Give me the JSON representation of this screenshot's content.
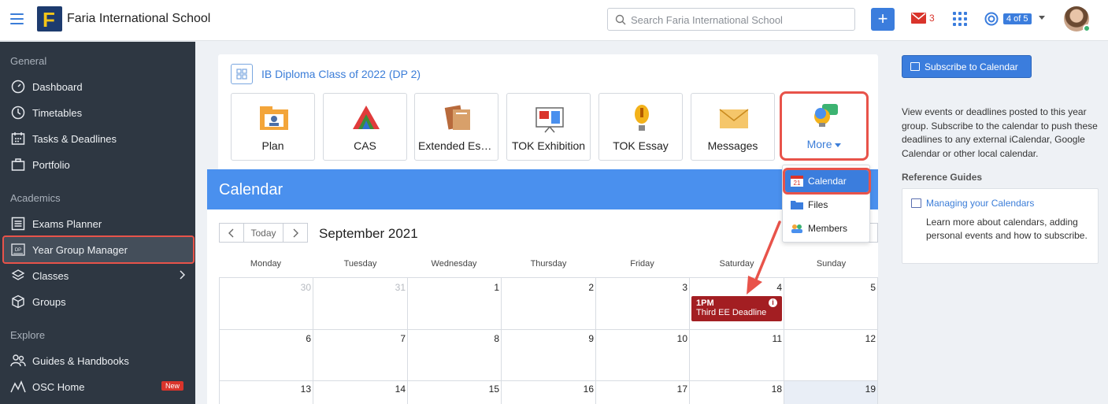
{
  "header": {
    "school_name": "Faria International School",
    "search_placeholder": "Search Faria International School",
    "plus_label": "+",
    "mail_count": "3",
    "help_badge": "4 of 5"
  },
  "sidebar": {
    "sections": {
      "general": "General",
      "academics": "Academics",
      "explore": "Explore"
    },
    "items": [
      {
        "label": "Dashboard"
      },
      {
        "label": "Timetables"
      },
      {
        "label": "Tasks & Deadlines"
      },
      {
        "label": "Portfolio"
      },
      {
        "label": "Exams Planner"
      },
      {
        "label": "Year Group Manager"
      },
      {
        "label": "Classes"
      },
      {
        "label": "Groups"
      },
      {
        "label": "Guides & Handbooks"
      },
      {
        "label": "OSC Home"
      }
    ],
    "new_badge": "New",
    "dp_icon_text": "DP"
  },
  "class_header": {
    "title": "IB Diploma Class of 2022 (DP 2)"
  },
  "tiles": [
    {
      "label": "Plan"
    },
    {
      "label": "CAS"
    },
    {
      "label": "Extended Essay"
    },
    {
      "label": "TOK Exhibition"
    },
    {
      "label": "TOK Essay"
    },
    {
      "label": "Messages"
    },
    {
      "label": "More"
    }
  ],
  "dropdown": [
    {
      "label": "Calendar",
      "icon_text": "21"
    },
    {
      "label": "Files"
    },
    {
      "label": "Members"
    }
  ],
  "calendar": {
    "title": "Calendar",
    "today_label": "Today",
    "month": "September 2021",
    "days_of_week": [
      "Monday",
      "Tuesday",
      "Wednesday",
      "Thursday",
      "Friday",
      "Saturday",
      "Sunday"
    ],
    "weeks": [
      [
        "30",
        "31",
        "1",
        "2",
        "3",
        "4",
        "5"
      ],
      [
        "6",
        "7",
        "8",
        "9",
        "10",
        "11",
        "12"
      ],
      [
        "13",
        "14",
        "15",
        "16",
        "17",
        "18",
        "19"
      ]
    ],
    "event": {
      "time": "1PM",
      "title": "Third EE Deadline",
      "info_mark": "i"
    }
  },
  "right_panel": {
    "subscribe_label": "Subscribe to Calendar",
    "description": "View events or deadlines posted to this year group. Subscribe to the calendar to push these deadlines to any external iCalendar, Google Calendar or other local calendar.",
    "ref_title": "Reference Guides",
    "ref_link": "Managing your Calendars",
    "ref_text": "Learn more about calendars, adding personal events and how to subscribe."
  },
  "colors": {
    "accent": "#3b7ddd",
    "highlight": "#e8534a",
    "event": "#a31e22",
    "sidebar_bg": "#2e3742"
  }
}
